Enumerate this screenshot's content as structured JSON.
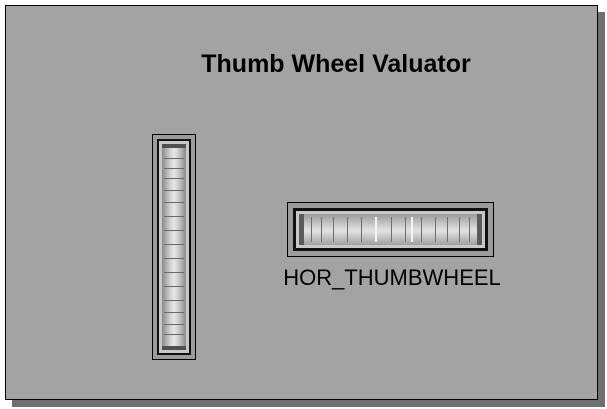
{
  "window": {
    "title": "Thumb Wheel Valuator"
  },
  "vertical_wheel": {
    "icon": "vertical-thumbwheel-icon"
  },
  "horizontal_wheel": {
    "label": "HOR_THUMBWHEEL",
    "icon": "horizontal-thumbwheel-icon"
  },
  "colors": {
    "panel_bg": "#a3a3a3",
    "shadow": "#6f6f6f",
    "border": "#000000"
  }
}
